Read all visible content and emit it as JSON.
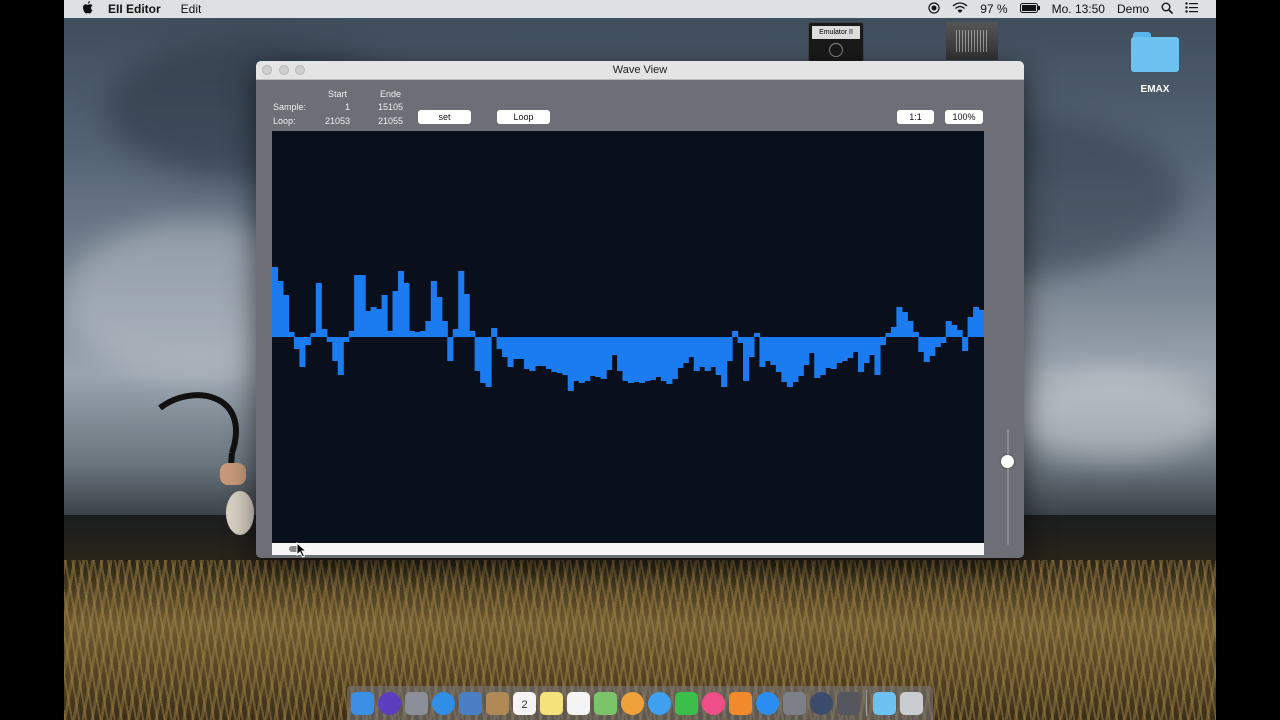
{
  "menubar": {
    "app_name": "EII Editor",
    "menus": [
      "Edit"
    ],
    "battery": "97 %",
    "clock": "Mo. 13:50",
    "user": "Demo"
  },
  "desktop": {
    "disk_label": "Emulator II",
    "folder_label": "EMAX"
  },
  "window": {
    "title": "Wave View",
    "header_start": "Start",
    "header_end": "Ende",
    "sample_label": "Sample:",
    "sample_start": "1",
    "sample_end": "15105",
    "loop_label": "Loop:",
    "loop_start": "21053",
    "loop_end": "21055",
    "set_button": "set",
    "loop_button": "Loop",
    "ratio_button": "1:1",
    "zoom_button": "100%",
    "wave_color": "#1a7cf0",
    "wave_bg": "#0a101b",
    "volume_level": 0.72
  },
  "waveform": {
    "amplitudes": [
      0.7,
      0.56,
      0.42,
      0.05,
      -0.12,
      -0.3,
      -0.08,
      0.04,
      0.54,
      0.08,
      -0.05,
      -0.24,
      -0.38,
      -0.05,
      0.06,
      0.62,
      0.62,
      0.26,
      0.3,
      0.28,
      0.42,
      0.06,
      0.46,
      0.66,
      0.54,
      0.06,
      0.05,
      0.06,
      0.16,
      0.56,
      0.4,
      0.16,
      -0.24,
      0.08,
      0.66,
      0.43,
      0.06,
      -0.34,
      -0.46,
      -0.5,
      0.09,
      -0.12,
      -0.2,
      -0.3,
      -0.22,
      -0.22,
      -0.32,
      -0.34,
      -0.29,
      -0.29,
      -0.32,
      -0.35,
      -0.36,
      -0.38,
      -0.54,
      -0.44,
      -0.46,
      -0.44,
      -0.39,
      -0.4,
      -0.42,
      -0.33,
      -0.18,
      -0.34,
      -0.44,
      -0.46,
      -0.45,
      -0.46,
      -0.44,
      -0.43,
      -0.4,
      -0.44,
      -0.47,
      -0.42,
      -0.31,
      -0.26,
      -0.2,
      -0.34,
      -0.3,
      -0.34,
      -0.3,
      -0.38,
      -0.5,
      -0.24,
      0.06,
      -0.06,
      -0.44,
      -0.2,
      0.04,
      -0.3,
      -0.24,
      -0.28,
      -0.35,
      -0.45,
      -0.5,
      -0.45,
      -0.39,
      -0.28,
      -0.16,
      -0.41,
      -0.38,
      -0.31,
      -0.32,
      -0.26,
      -0.24,
      -0.21,
      -0.15,
      -0.35,
      -0.26,
      -0.18,
      -0.38,
      -0.08,
      0.04,
      0.1,
      0.3,
      0.25,
      0.16,
      0.05,
      -0.15,
      -0.25,
      -0.19,
      -0.1,
      -0.06,
      0.16,
      0.12,
      0.07,
      -0.14,
      0.2,
      0.3,
      0.27
    ]
  },
  "dock": {
    "items": [
      "finder-icon",
      "siri-icon",
      "launchpad-icon",
      "safari-icon",
      "photo-browser-icon",
      "contacts-icon",
      "calendar-icon",
      "notes-icon",
      "reminders-icon",
      "maps-icon",
      "photos-icon",
      "messages-icon",
      "facetime-icon",
      "itunes-icon",
      "ibooks-icon",
      "appstore-icon",
      "system-preferences-icon",
      "quicktime-icon",
      "eii-editor-icon",
      "downloads-folder-icon",
      "trash-icon"
    ],
    "calendar_day": "2"
  }
}
